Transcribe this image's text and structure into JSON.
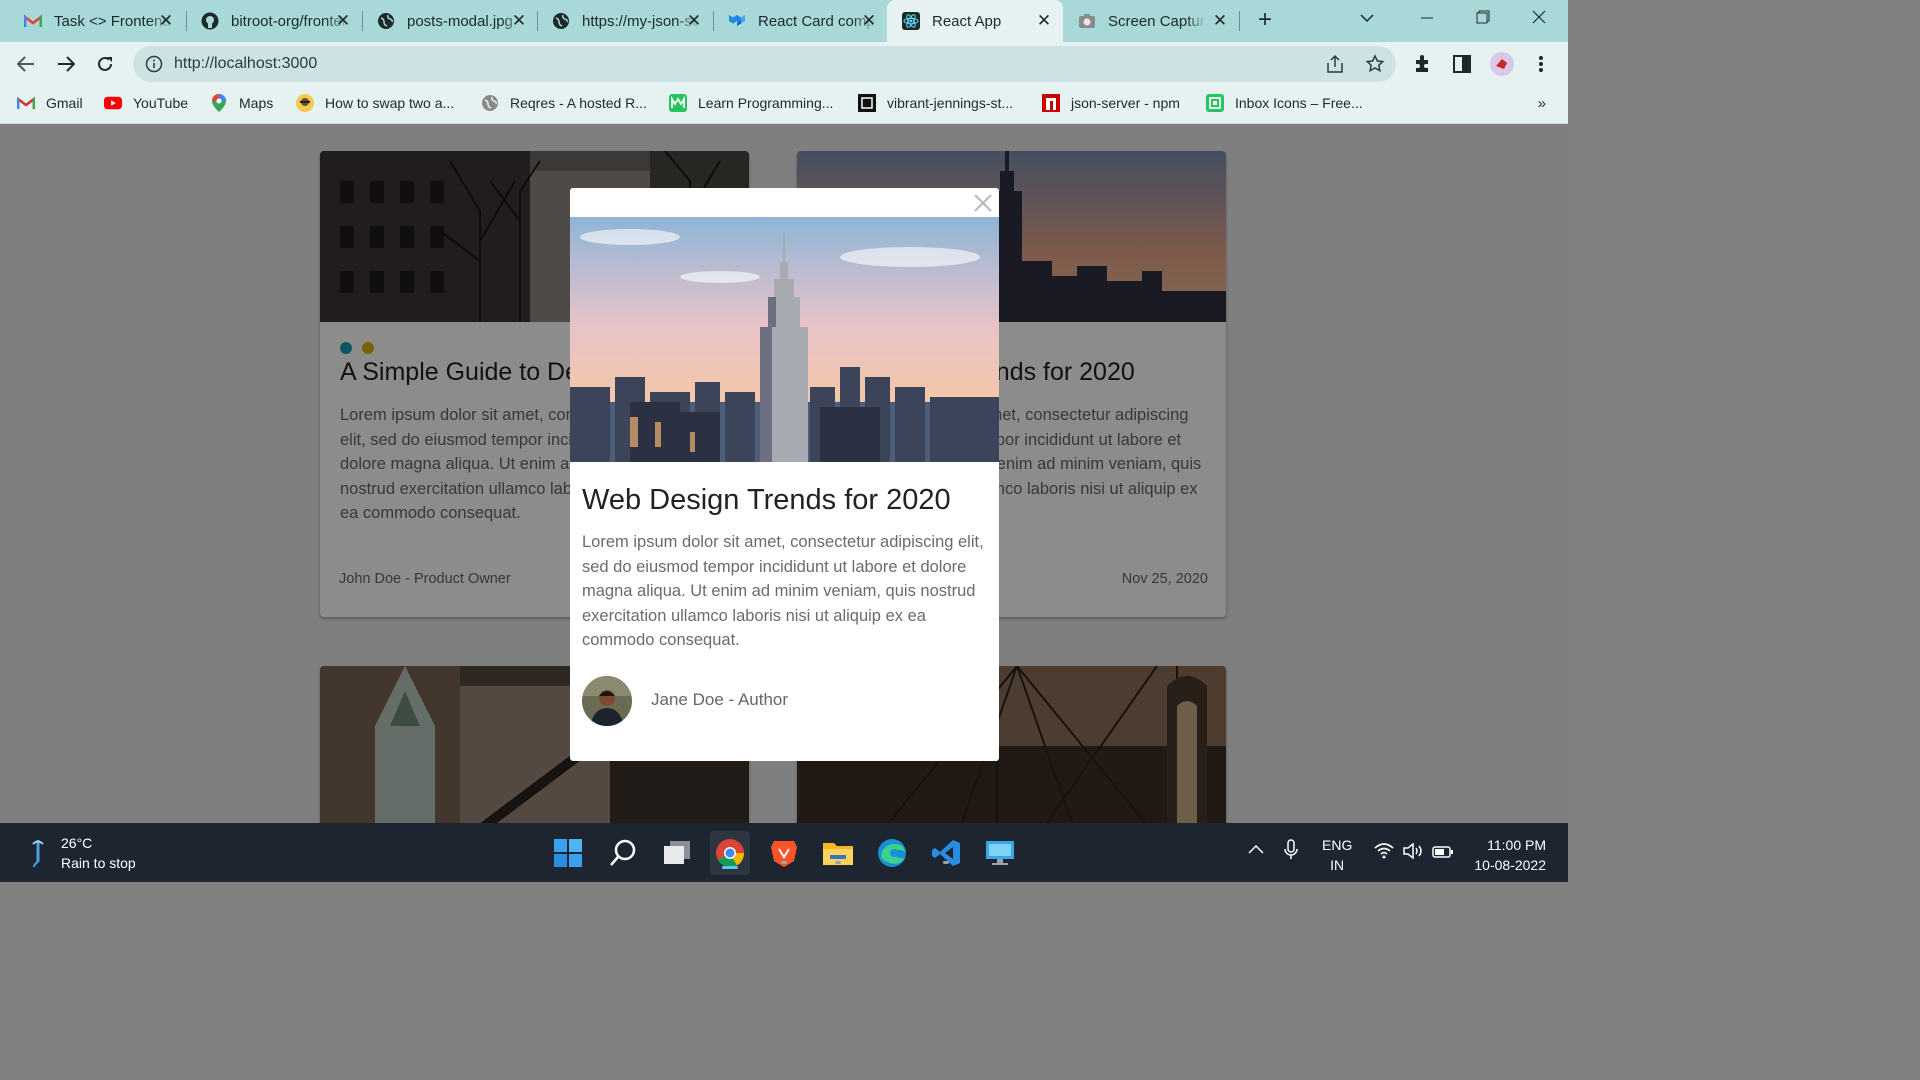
{
  "browser": {
    "tabs": [
      {
        "title": "Task <> Frontend",
        "icon": "gmail-icon"
      },
      {
        "title": "bitroot-org/frontend",
        "icon": "github-icon"
      },
      {
        "title": "posts-modal.jpg",
        "icon": "globe-icon"
      },
      {
        "title": "https://my-json-server",
        "icon": "globe-icon"
      },
      {
        "title": "React Card component",
        "icon": "mui-icon"
      },
      {
        "title": "React App",
        "icon": "react-icon",
        "active": true
      },
      {
        "title": "Screen Capture",
        "icon": "camera-icon"
      }
    ],
    "new_tab": "+",
    "url": "http://localhost:3000",
    "bookmarks": [
      {
        "label": "Gmail",
        "icon": "gmail-icon"
      },
      {
        "label": "YouTube",
        "icon": "youtube-icon"
      },
      {
        "label": "Maps",
        "icon": "maps-icon"
      },
      {
        "label": "How to swap two a...",
        "icon": "stackoverflow-avatar-icon"
      },
      {
        "label": "Reqres - A hosted R...",
        "icon": "reqres-icon"
      },
      {
        "label": "Learn Programming...",
        "icon": "learn-icon"
      },
      {
        "label": "vibrant-jennings-st...",
        "icon": "codesandbox-icon"
      },
      {
        "label": "json-server - npm",
        "icon": "npm-icon"
      },
      {
        "label": "Inbox Icons – Free...",
        "icon": "inbox-icons-icon"
      }
    ],
    "more_bookmarks": "»"
  },
  "page": {
    "cards": [
      {
        "title": "A Simple Guide to De",
        "body": "Lorem ipsum dolor sit amet, consectetur adipiscing elit, sed do eiusmod tempor incididunt ut labore et dolore magna aliqua. Ut enim ad minim veniam, quis nostrud exercitation ullamco laboris nisi ut aliquip ex ea commodo consequat.",
        "footer": "John Doe - Product Owner",
        "dot_colors": [
          "#1a9bb4",
          "#e0b010"
        ]
      },
      {
        "title": "Web Design Trends for 2020",
        "body": "Lorem ipsum dolor sit amet, consectetur adipiscing elit, sed do eiusmod tempor incididunt ut labore et dolore magna aliqua. Ut enim ad minim veniam, quis nostrud exercitation ullamco laboris nisi ut aliquip ex ea commodo consequat.",
        "date": "Nov 25, 2020"
      }
    ],
    "modal": {
      "title": "Web Design Trends for 2020",
      "body": "Lorem ipsum dolor sit amet, consectetur adipiscing elit, sed do eiusmod tempor incididunt ut labore et dolore magna aliqua. Ut enim ad minim veniam, quis nostrud exercitation ullamco laboris nisi ut aliquip ex ea commodo consequat.",
      "author": "Jane Doe - Author",
      "close_icon": "close-icon"
    }
  },
  "taskbar": {
    "weather_temp": "26°C",
    "weather_desc": "Rain to stop",
    "lang_line1": "ENG",
    "lang_line2": "IN",
    "time": "11:00 PM",
    "date": "10-08-2022",
    "apps": [
      "start-icon",
      "search-icon",
      "task-view-icon",
      "chrome-icon",
      "brave-icon",
      "file-explorer-icon",
      "edge-icon",
      "vscode-icon",
      "remote-desktop-icon"
    ]
  },
  "colors": {
    "tab_strip": "#a8d8d8",
    "toolbar": "#e6f2f2",
    "taskbar": "#1c2530"
  }
}
